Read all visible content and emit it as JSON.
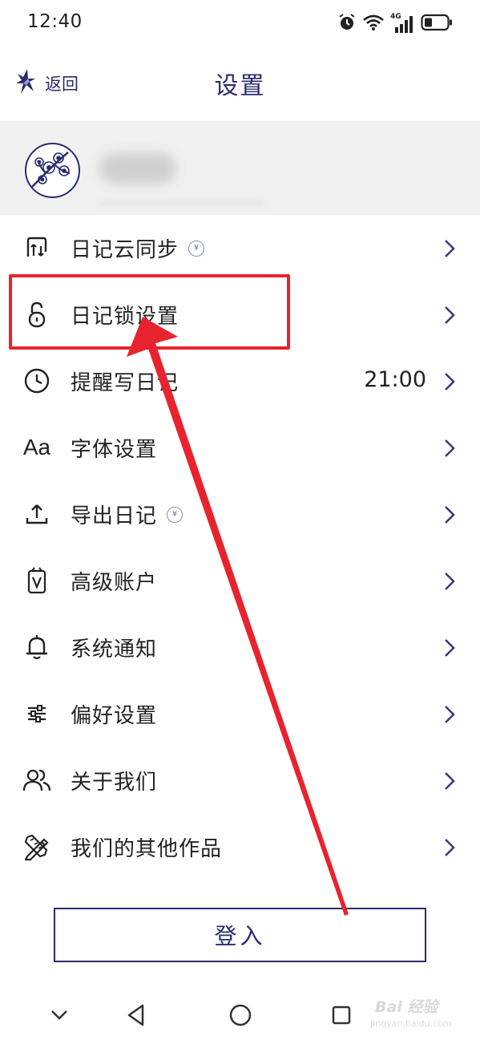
{
  "status_bar": {
    "time": "12:40",
    "network_label": "4G",
    "icons": [
      "alarm-icon",
      "wifi-icon",
      "signal-icon",
      "battery-icon"
    ]
  },
  "header": {
    "back_label": "返回",
    "title": "设置"
  },
  "menu": {
    "items": [
      {
        "label": "日记云同步",
        "icon": "cloud-sync-icon",
        "coin": "¥",
        "value": ""
      },
      {
        "label": "日记锁设置",
        "icon": "lock-icon",
        "coin": "",
        "value": ""
      },
      {
        "label": "提醒写日记",
        "icon": "clock-icon",
        "coin": "",
        "value": "21:00"
      },
      {
        "label": "字体设置",
        "icon": "font-icon",
        "glyph": "Aa",
        "coin": "",
        "value": ""
      },
      {
        "label": "导出日记",
        "icon": "export-icon",
        "coin": "¥",
        "value": ""
      },
      {
        "label": "高级账户",
        "icon": "premium-account-icon",
        "coin": "",
        "value": ""
      },
      {
        "label": "系统通知",
        "icon": "bell-icon",
        "coin": "",
        "value": ""
      },
      {
        "label": "偏好设置",
        "icon": "sliders-icon",
        "coin": "",
        "value": ""
      },
      {
        "label": "关于我们",
        "icon": "people-icon",
        "coin": "",
        "value": ""
      },
      {
        "label": "我们的其他作品",
        "icon": "tools-icon",
        "coin": "",
        "value": ""
      }
    ]
  },
  "login": {
    "label": "登入"
  },
  "watermark": {
    "text": "Bai 经验",
    "sub": "jingyan.baidu.com"
  },
  "colors": {
    "accent": "#2a2c6e",
    "highlight": "#e8232d",
    "profile_bg": "#f0f0f0"
  }
}
